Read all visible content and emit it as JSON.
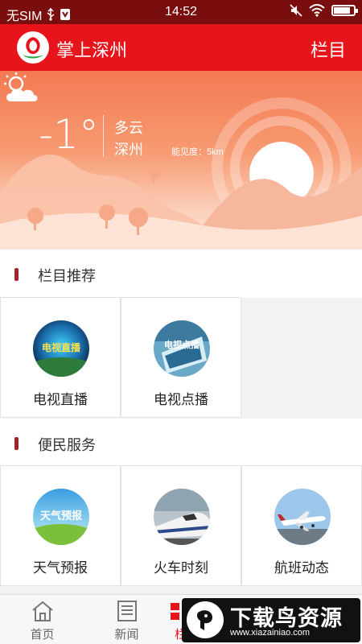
{
  "status_bar": {
    "carrier": "无SIM",
    "time": "14:52",
    "battery_level": 0.85
  },
  "header": {
    "title": "掌上深州",
    "menu_label": "栏目"
  },
  "weather": {
    "temperature": "-1°",
    "condition": "多云",
    "city": "深州",
    "visibility": "能见度：5km"
  },
  "sections": {
    "recommended": {
      "label": "栏目推荐",
      "items": [
        {
          "label": "电视直播",
          "icon": "tv-live-icon",
          "caption": "电视直播"
        },
        {
          "label": "电视点播",
          "icon": "tv-vod-icon",
          "caption": "电视点播"
        }
      ]
    },
    "services": {
      "label": "便民服务",
      "items": [
        {
          "label": "天气预报",
          "icon": "weather-forecast-icon",
          "caption": "天气预报"
        },
        {
          "label": "火车时刻",
          "icon": "train-icon"
        },
        {
          "label": "航班动态",
          "icon": "airplane-icon"
        }
      ]
    }
  },
  "bottom_nav": {
    "items": [
      {
        "label": "首页",
        "icon": "home-icon"
      },
      {
        "label": "新闻",
        "icon": "news-icon"
      },
      {
        "label": "栏",
        "icon": "columns-icon"
      }
    ]
  },
  "watermark": {
    "text": "下载鸟资源",
    "url": "www.xiazainiao.com"
  },
  "colors": {
    "header": "#e8141b",
    "status_bar": "#7a0d0d",
    "section_marker": "#a3232a",
    "active_nav": "#e8141b"
  }
}
